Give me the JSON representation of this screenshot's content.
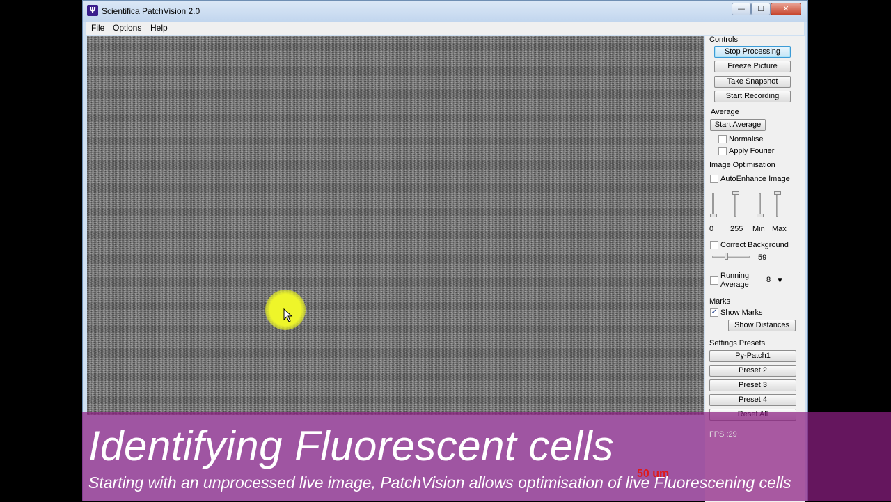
{
  "window": {
    "title": "Scientifica PatchVision 2.0",
    "app_icon_glyph": "Ψ",
    "minimize_glyph": "—",
    "maximize_glyph": "☐",
    "close_glyph": "✕"
  },
  "menu": {
    "file": "File",
    "options": "Options",
    "help": "Help"
  },
  "controls": {
    "heading": "Controls",
    "stop_processing": "Stop Processing",
    "freeze_picture": "Freeze Picture",
    "take_snapshot": "Take Snapshot",
    "start_recording": "Start Recording"
  },
  "average": {
    "heading": "Average",
    "start_average": "Start Average",
    "normalise": "Normalise",
    "normalise_checked": false,
    "apply_fourier": "Apply Fourier",
    "apply_fourier_checked": false
  },
  "image_opt": {
    "heading": "Image Optimisation",
    "auto_enhance": "AutoEnhance Image",
    "auto_enhance_checked": false,
    "slider_labels": [
      "0",
      "255",
      "Min",
      "Max"
    ],
    "correct_background": "Correct Background",
    "correct_background_checked": false,
    "background_value": "59",
    "running_average_line1": "Running",
    "running_average_line2": "Average",
    "running_average_checked": false,
    "running_average_value": "8"
  },
  "marks": {
    "heading": "Marks",
    "show_marks": "Show Marks",
    "show_marks_checked": true,
    "show_marks_check_glyph": "✓",
    "show_distances": "Show Distances"
  },
  "presets": {
    "heading": "Settings Presets",
    "items": [
      "Py-Patch1",
      "Preset 2",
      "Preset 3",
      "Preset 4"
    ],
    "reset_all": "Reset All"
  },
  "status": {
    "fps": "FPS :29",
    "scale_bar": "50 um"
  },
  "caption": {
    "title": "Identifying Fluorescent cells",
    "subtitle": "Starting with an unprocessed live image, PatchVision allows optimisation of live Fluorescening cells"
  },
  "colors": {
    "banner": "#8c1e82",
    "cursor_highlight": "#eef52a",
    "scale_bar_text": "#e01a1a"
  }
}
